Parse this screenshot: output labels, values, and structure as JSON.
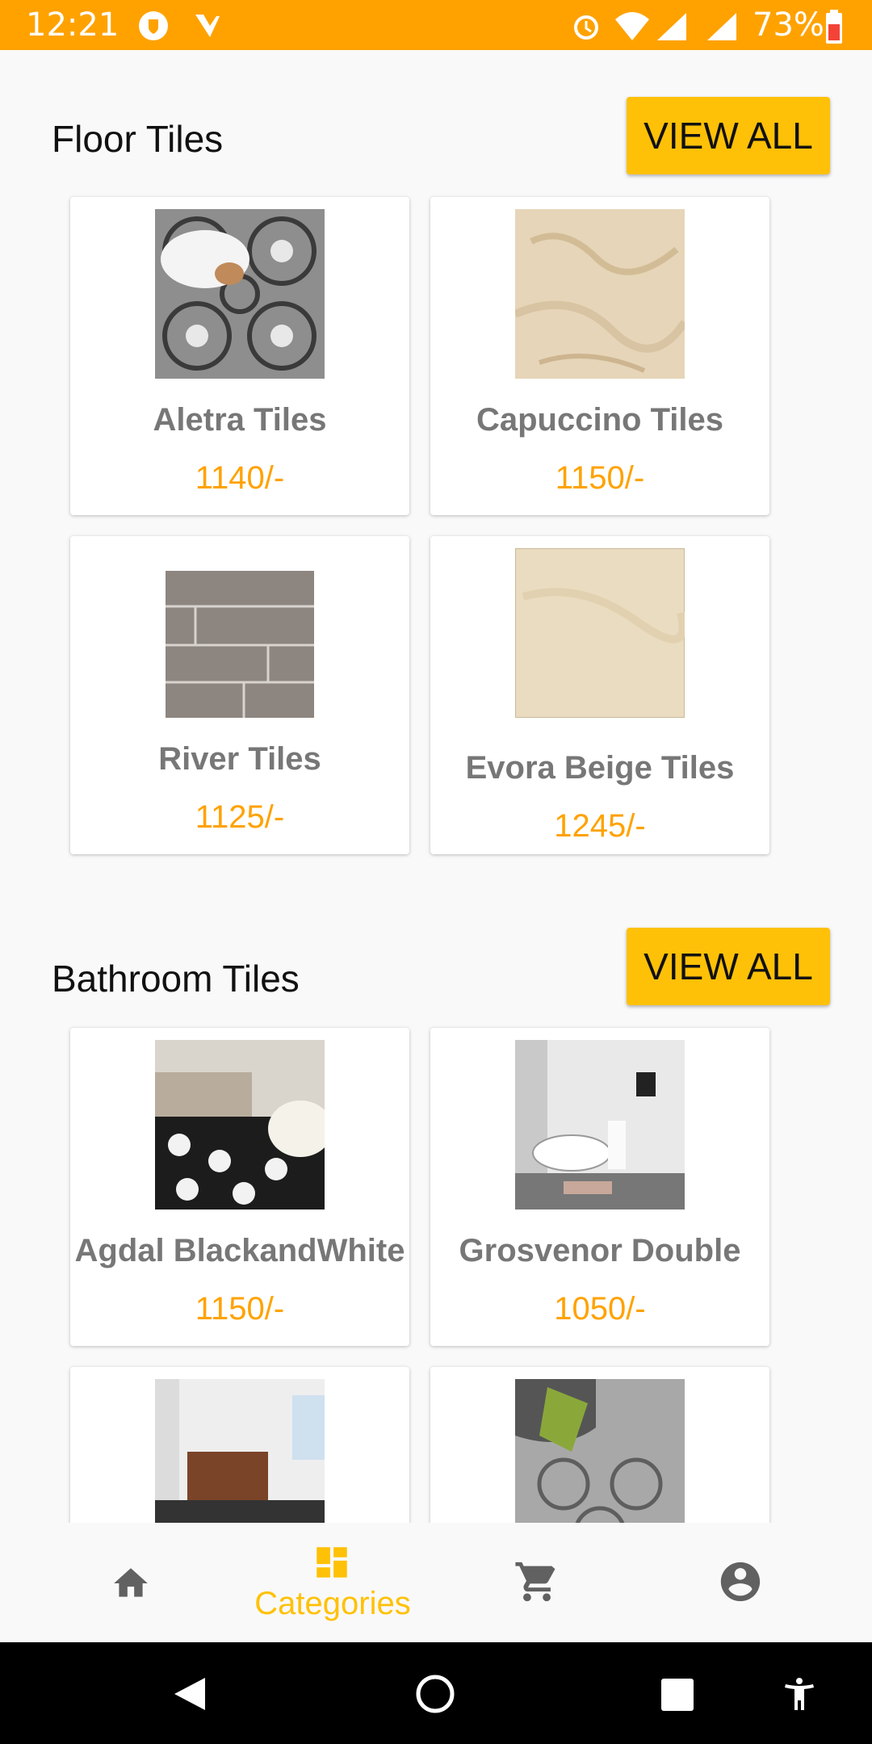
{
  "status_bar": {
    "time": "12:21",
    "battery": "73%",
    "icons": [
      "shield-icon",
      "check-icon",
      "alarm-icon",
      "wifi-icon",
      "signal-icon",
      "signal-icon",
      "battery-icon"
    ]
  },
  "sections": [
    {
      "title": "Floor Tiles",
      "view_all": "VIEW ALL",
      "products": [
        {
          "name": "Aletra Tiles",
          "price": "1140/-",
          "image": "patterned-tile-with-dog"
        },
        {
          "name": "Capuccino Tiles",
          "price": "1150/-",
          "image": "beige-marble-tile"
        },
        {
          "name": "River Tiles",
          "price": "1125/-",
          "image": "grey-wood-plank-tile"
        },
        {
          "name": "Evora Beige Tiles",
          "price": "1245/-",
          "image": "light-beige-tile"
        }
      ]
    },
    {
      "title": "Bathroom Tiles",
      "view_all": "VIEW ALL",
      "products": [
        {
          "name": "Agdal BlackandWhite",
          "price": "1150/-",
          "image": "black-white-floral-bathroom"
        },
        {
          "name": "Grosvenor Double",
          "price": "1050/-",
          "image": "bathroom-with-tub"
        },
        {
          "name": "",
          "price": "",
          "image": "bathroom-vanity"
        },
        {
          "name": "",
          "price": "",
          "image": "grey-patterned-bathroom"
        }
      ]
    }
  ],
  "bottom_nav": {
    "items": [
      {
        "icon": "home-icon",
        "label": ""
      },
      {
        "icon": "categories-icon",
        "label": "Categories",
        "active": true
      },
      {
        "icon": "cart-icon",
        "label": ""
      },
      {
        "icon": "account-icon",
        "label": ""
      }
    ]
  },
  "colors": {
    "status_bar": "#ffa200",
    "accent": "#ffc107",
    "price": "#ffa200",
    "inactive_icon": "#616161"
  }
}
